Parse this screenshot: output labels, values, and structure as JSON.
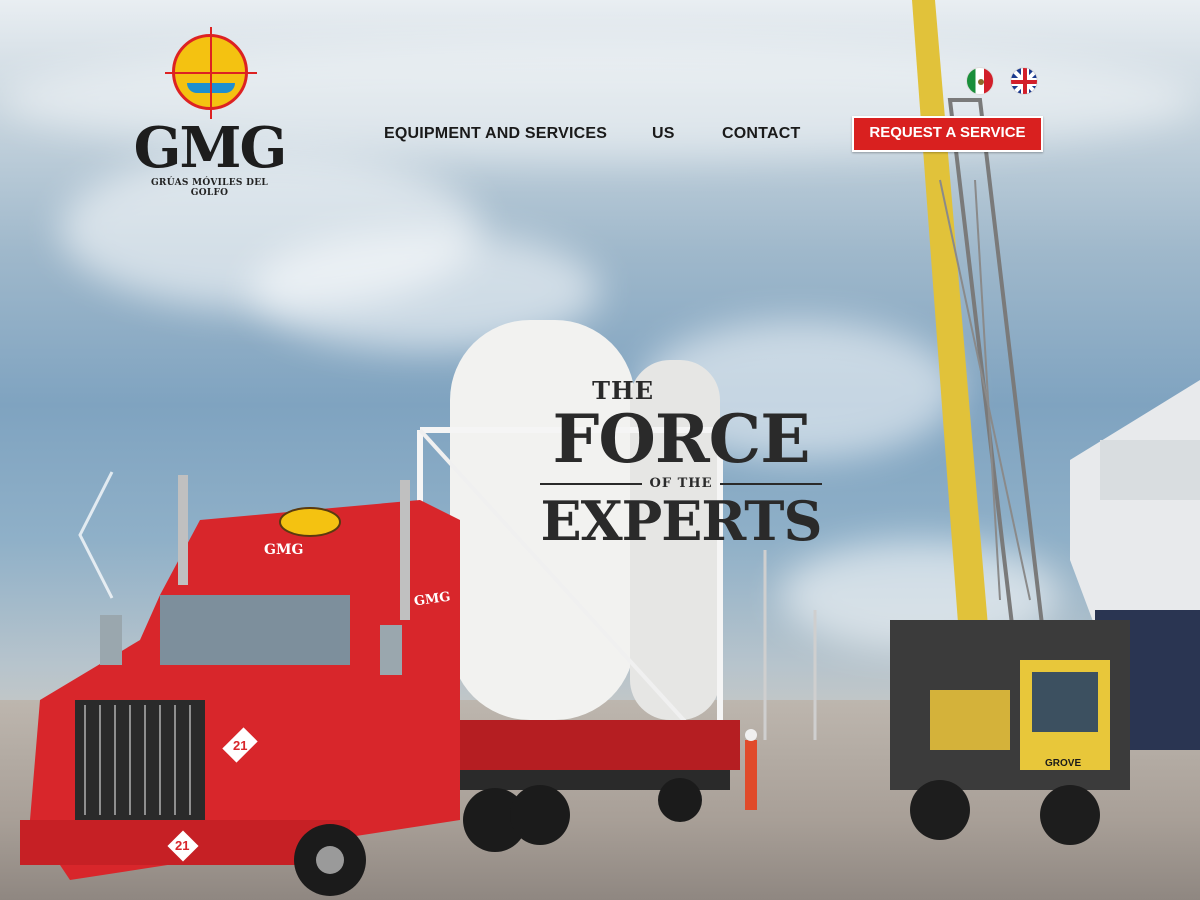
{
  "brand": {
    "name": "GMG",
    "tagline": "GRÚAS MÓVILES DEL GOLFO"
  },
  "nav": {
    "items": [
      {
        "label": "EQUIPMENT AND SERVICES"
      },
      {
        "label": "US"
      },
      {
        "label": "CONTACT"
      }
    ],
    "cta_label": "REQUEST A SERVICE"
  },
  "languages": [
    {
      "name": "mexico-flag-icon"
    },
    {
      "name": "uk-flag-icon"
    }
  ],
  "hero": {
    "line1": "THE",
    "line2": "FORCE",
    "line3": "OF THE",
    "line4": "EXPERTS",
    "truck_label": "GMG",
    "truck_number": "21",
    "crane_brand": "GROVE"
  },
  "colors": {
    "accent": "#d9201f",
    "logo_yellow": "#f4c211",
    "text_dark": "#1a1a1a",
    "truck_red": "#d8262b",
    "crane_yellow": "#e8c73a"
  }
}
